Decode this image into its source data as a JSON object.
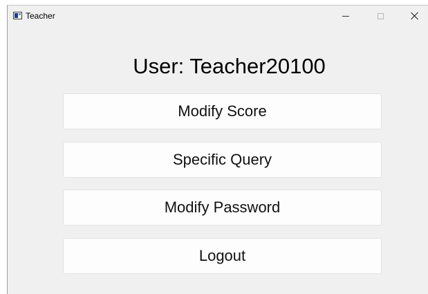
{
  "window": {
    "title": "Teacher",
    "icon": "app-window-icon",
    "controls": {
      "minimize_icon": "minimize-icon",
      "maximize_icon": "maximize-icon",
      "close_icon": "close-icon"
    }
  },
  "main": {
    "user_label": "User: Teacher20100",
    "buttons": [
      {
        "label": "Modify Score"
      },
      {
        "label": "Specific Query"
      },
      {
        "label": "Modify Password"
      },
      {
        "label": "Logout"
      }
    ]
  },
  "colors": {
    "window_background": "#f0f0f0",
    "button_background": "#fdfdfd",
    "button_border": "#e2e2e2",
    "text": "#000000"
  }
}
